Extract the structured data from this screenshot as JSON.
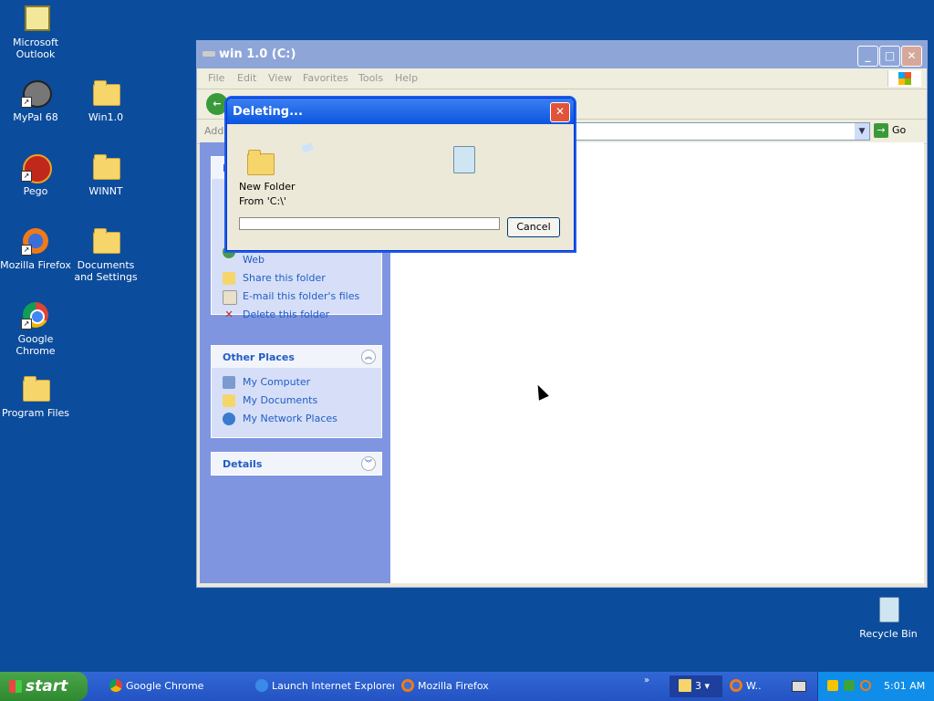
{
  "desktop": {
    "icons": [
      {
        "label": "Microsoft Outlook"
      },
      {
        "label": "MyPal 68"
      },
      {
        "label": "Win1.0"
      },
      {
        "label": "Pego"
      },
      {
        "label": "WINNT"
      },
      {
        "label": "Mozilla Firefox"
      },
      {
        "label": "Documents and Settings"
      },
      {
        "label": "Google Chrome"
      },
      {
        "label": "Program Files"
      },
      {
        "label": "Recycle Bin"
      }
    ]
  },
  "explorer": {
    "title": "win 1.0 (C:)",
    "menu": [
      "File",
      "Edit",
      "View",
      "Favorites",
      "Tools",
      "Help"
    ],
    "address_label": "Addre",
    "go_label": "Go",
    "tasks": {
      "partial_header": "F",
      "partial_item": "Publish this folder to the Web",
      "items": [
        "Share this folder",
        "E-mail this folder's files",
        "Delete this folder"
      ]
    },
    "other_places": {
      "title": "Other Places",
      "items": [
        "My Computer",
        "My Documents",
        "My Network Places"
      ]
    },
    "details": {
      "title": "Details"
    }
  },
  "dialog": {
    "title": "Deleting...",
    "item_name": "New Folder",
    "from_text": "From 'C:\\'",
    "progress": 0,
    "cancel_label": "Cancel"
  },
  "taskbar": {
    "start_label": "start",
    "tasks": [
      "Google Chrome",
      "Launch Internet Explorer...",
      "Mozilla Firefox"
    ],
    "group_count": "3",
    "group_label": "W..",
    "clock": "5:01 AM"
  }
}
